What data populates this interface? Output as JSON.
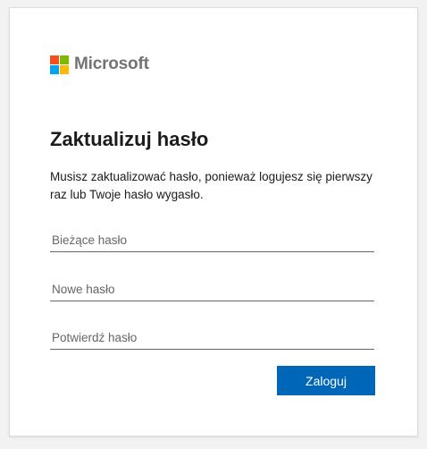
{
  "brand": {
    "name": "Microsoft",
    "logo_colors": [
      "#f25022",
      "#7fba00",
      "#00a4ef",
      "#ffb900"
    ]
  },
  "form": {
    "title": "Zaktualizuj hasło",
    "description": "Musisz zaktualizować hasło, ponieważ logujesz się pierwszy raz lub Twoje hasło wygasło.",
    "fields": [
      {
        "placeholder": "Bieżące hasło",
        "value": ""
      },
      {
        "placeholder": "Nowe hasło",
        "value": ""
      },
      {
        "placeholder": "Potwierdź hasło",
        "value": ""
      }
    ],
    "submit_label": "Zaloguj"
  },
  "colors": {
    "accent": "#0067b8"
  }
}
